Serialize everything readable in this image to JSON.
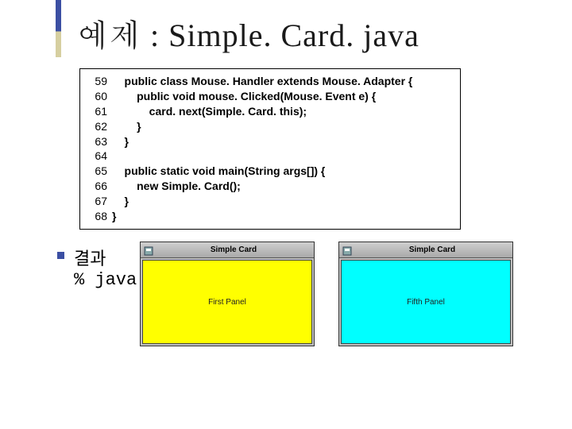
{
  "title": "예제 : Simple. Card. java",
  "code": {
    "lines": [
      {
        "n": "59",
        "t": "    public class Mouse. Handler extends Mouse. Adapter {"
      },
      {
        "n": "60",
        "t": "        public void mouse. Clicked(Mouse. Event e) {"
      },
      {
        "n": "61",
        "t": "            card. next(Simple. Card. this);"
      },
      {
        "n": "62",
        "t": "        }"
      },
      {
        "n": "63",
        "t": "    }"
      },
      {
        "n": "64",
        "t": ""
      },
      {
        "n": "65",
        "t": "    public static void main(String args[]) {"
      },
      {
        "n": "66",
        "t": "        new Simple. Card();"
      },
      {
        "n": "67",
        "t": "    }"
      },
      {
        "n": "68",
        "t": "}"
      }
    ]
  },
  "result": {
    "label": "결과",
    "command": "% java Simp"
  },
  "windows": [
    {
      "title": "Simple Card",
      "panel_label": "First Panel",
      "panel_color": "panel-yellow"
    },
    {
      "title": "Simple Card",
      "panel_label": "Fifth Panel",
      "panel_color": "panel-cyan"
    }
  ]
}
